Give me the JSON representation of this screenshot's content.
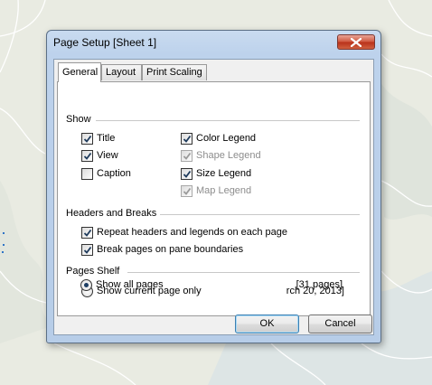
{
  "dialog": {
    "title": "Page Setup [Sheet 1]"
  },
  "tabs": [
    {
      "label": "General",
      "active": true
    },
    {
      "label": "Layout",
      "active": false
    },
    {
      "label": "Print Scaling",
      "active": false
    }
  ],
  "show": {
    "heading": "Show",
    "options": [
      {
        "label": "Title",
        "checked": true,
        "enabled": true
      },
      {
        "label": "View",
        "checked": true,
        "enabled": true
      },
      {
        "label": "Caption",
        "checked": false,
        "enabled": true
      },
      {
        "label": "Color Legend",
        "checked": true,
        "enabled": true
      },
      {
        "label": "Shape Legend",
        "checked": true,
        "enabled": false
      },
      {
        "label": "Size Legend",
        "checked": true,
        "enabled": true
      },
      {
        "label": "Map Legend",
        "checked": true,
        "enabled": false
      }
    ]
  },
  "headers_breaks": {
    "heading": "Headers and Breaks",
    "options": [
      {
        "label": "Repeat headers and legends on each page",
        "checked": true
      },
      {
        "label": "Break pages on pane boundaries",
        "checked": true
      }
    ]
  },
  "pages_shelf": {
    "heading": "Pages Shelf",
    "options": [
      {
        "label": "Show current page only",
        "selected": false,
        "info": "rch 20, 2013]"
      },
      {
        "label": "Show all pages",
        "selected": true,
        "info": "[31 pages]"
      }
    ]
  },
  "buttons": {
    "ok": "OK",
    "cancel": "Cancel"
  },
  "colors": {
    "titlebar": "#bdd2ec",
    "close_button": "#c8452d",
    "default_button_border": "#3c7fb1"
  }
}
